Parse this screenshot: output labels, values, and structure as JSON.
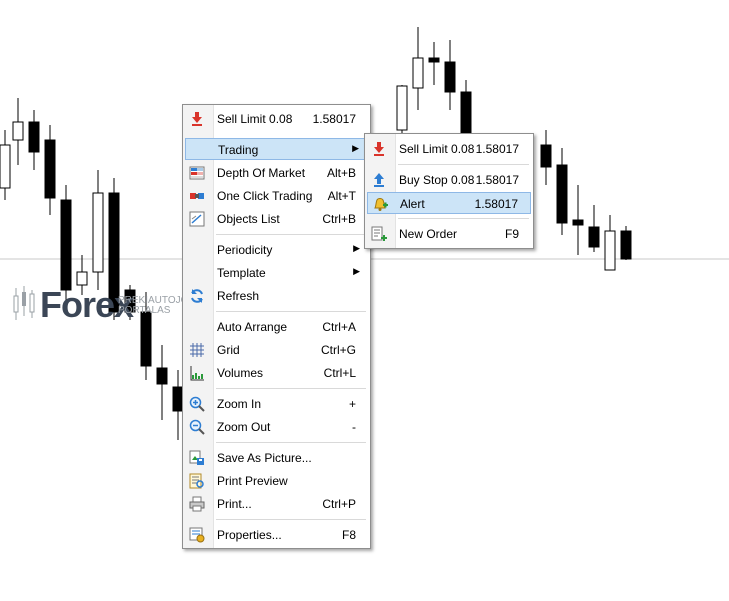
{
  "logo": {
    "word": "Forex",
    "sub_line1": "PREKIAUTOJO",
    "sub_line2": "PORTALAS"
  },
  "context_menu": {
    "items": [
      {
        "label": "Sell Limit 0.08",
        "shortcut": "1.58017",
        "icon": "sell-arrow-icon"
      },
      {
        "label": "Trading",
        "submenu": true
      },
      {
        "label": "Depth Of Market",
        "shortcut": "Alt+B",
        "icon": "depth-of-market-icon"
      },
      {
        "label": "One Click Trading",
        "shortcut": "Alt+T",
        "icon": "one-click-icon"
      },
      {
        "label": "Objects List",
        "shortcut": "Ctrl+B",
        "icon": "objects-list-icon"
      },
      {
        "label": "Periodicity",
        "submenu": true
      },
      {
        "label": "Template",
        "submenu": true
      },
      {
        "label": "Refresh",
        "icon": "refresh-icon"
      },
      {
        "label": "Auto Arrange",
        "shortcut": "Ctrl+A"
      },
      {
        "label": "Grid",
        "shortcut": "Ctrl+G",
        "icon": "grid-icon"
      },
      {
        "label": "Volumes",
        "shortcut": "Ctrl+L",
        "icon": "volumes-icon"
      },
      {
        "label": "Zoom In",
        "shortcut": "+",
        "icon": "zoom-in-icon"
      },
      {
        "label": "Zoom Out",
        "shortcut": "-",
        "icon": "zoom-out-icon"
      },
      {
        "label": "Save As Picture...",
        "icon": "save-picture-icon"
      },
      {
        "label": "Print Preview",
        "icon": "print-preview-icon"
      },
      {
        "label": "Print...",
        "shortcut": "Ctrl+P",
        "icon": "printer-icon"
      },
      {
        "label": "Properties...",
        "shortcut": "F8",
        "icon": "properties-icon"
      }
    ]
  },
  "trading_submenu": {
    "items": [
      {
        "label": "Sell Limit 0.08",
        "price": "1.58017",
        "icon": "sell-arrow-icon"
      },
      {
        "label": "Buy Stop 0.08",
        "price": "1.58017",
        "icon": "buy-arrow-icon"
      },
      {
        "label": "Alert",
        "price": "1.58017",
        "icon": "alert-bell-icon"
      },
      {
        "label": "New Order",
        "price": "F9",
        "icon": "new-order-icon"
      }
    ]
  },
  "colors": {
    "highlight": "#cce4f7",
    "highlight_border": "#8eb8e6",
    "sell_icon": "#d9342b",
    "buy_icon": "#2d7dd2",
    "price_line": "#c0c0c0"
  }
}
